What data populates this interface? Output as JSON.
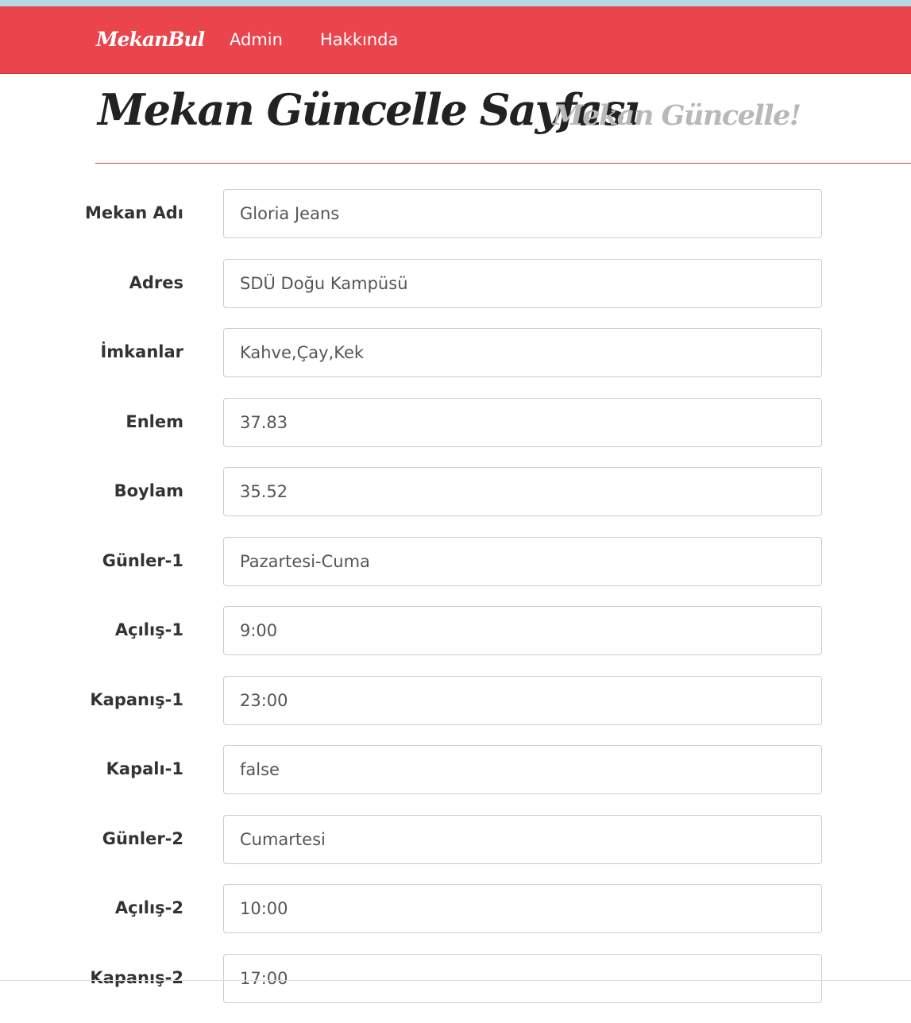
{
  "navbar": {
    "brand": "MekanBul",
    "links": [
      "Admin",
      "Hakkında"
    ]
  },
  "header": {
    "title": "Mekan Güncelle Sayfası",
    "subtitle": "Mekan Güncelle!"
  },
  "form": {
    "fields": [
      {
        "label": "Mekan Adı",
        "value": "Gloria Jeans"
      },
      {
        "label": "Adres",
        "value": "SDÜ Doğu Kampüsü"
      },
      {
        "label": "İmkanlar",
        "value": "Kahve,Çay,Kek"
      },
      {
        "label": "Enlem",
        "value": "37.83"
      },
      {
        "label": "Boylam",
        "value": "35.52"
      },
      {
        "label": "Günler-1",
        "value": "Pazartesi-Cuma"
      },
      {
        "label": "Açılış-1",
        "value": "9:00"
      },
      {
        "label": "Kapanış-1",
        "value": "23:00"
      },
      {
        "label": "Kapalı-1",
        "value": "false"
      },
      {
        "label": "Günler-2",
        "value": "Cumartesi"
      },
      {
        "label": "Açılış-2",
        "value": "10:00"
      },
      {
        "label": "Kapanış-2",
        "value": "17:00"
      }
    ]
  },
  "colors": {
    "navbar": "#ea444c",
    "top_strip": "#b5d9df",
    "header_rule": "#b44a4e",
    "subtitle": "#b8b8b8"
  }
}
